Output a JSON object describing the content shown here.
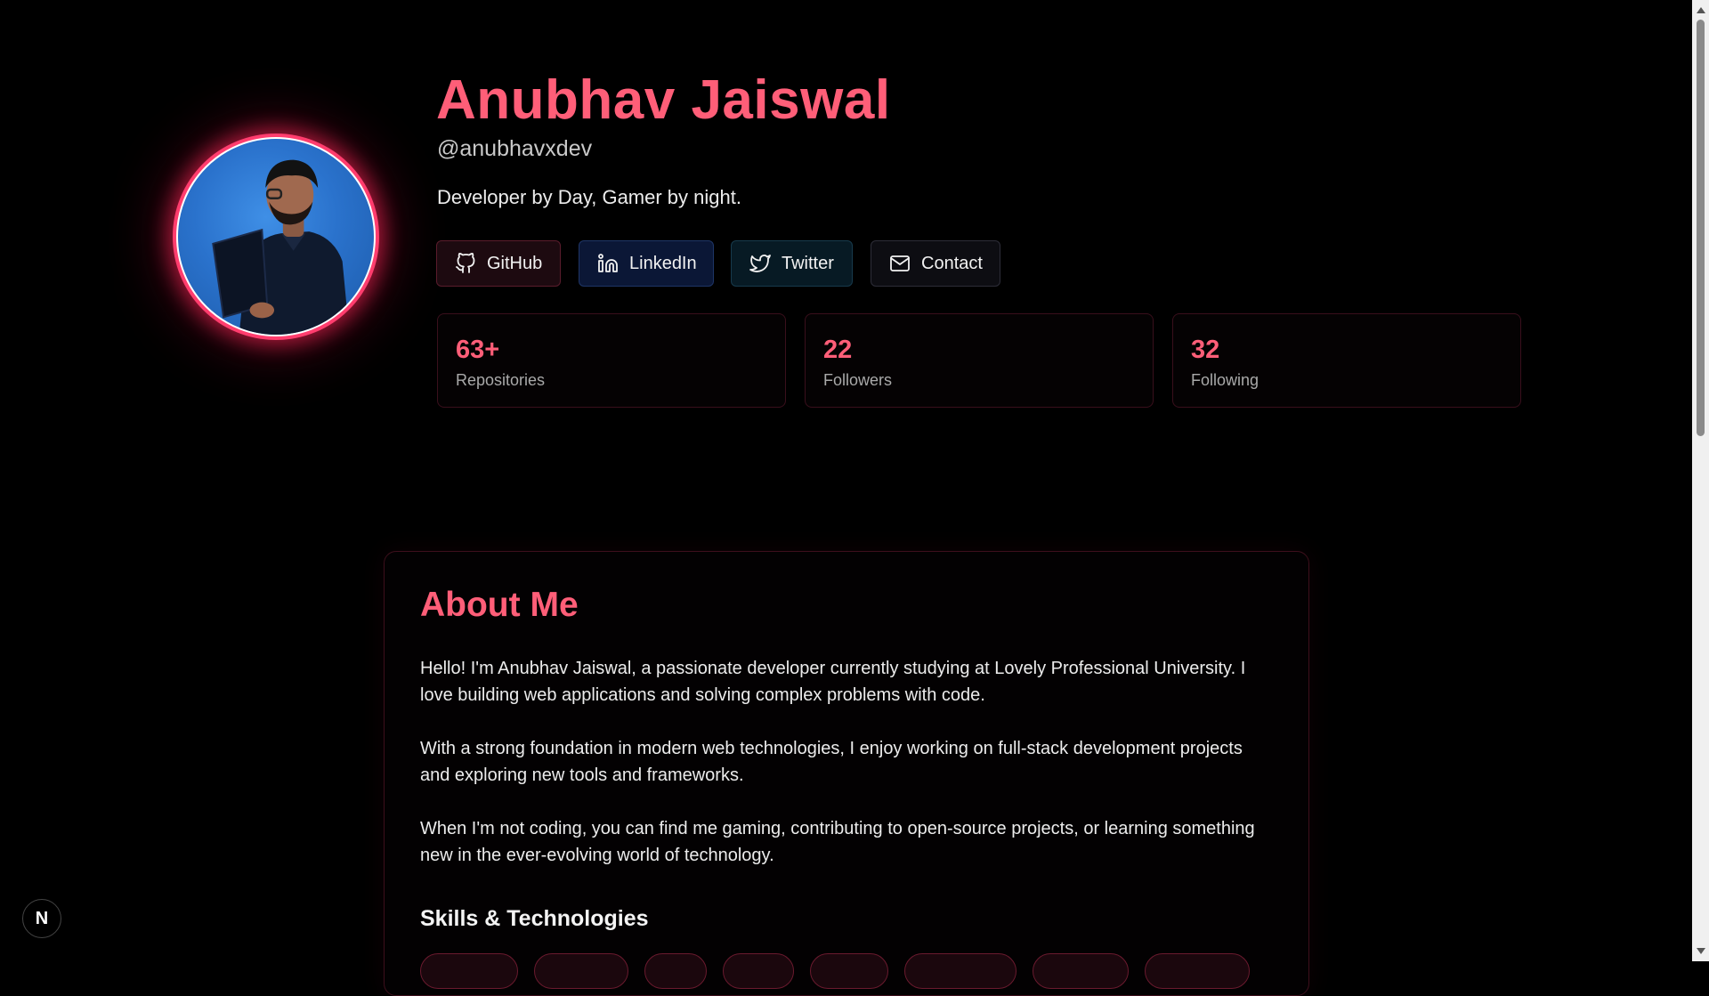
{
  "profile": {
    "name": "Anubhav Jaiswal",
    "handle": "@anubhavxdev",
    "tagline": "Developer by Day, Gamer by night.",
    "avatar_icon": "profile-photo"
  },
  "social": {
    "github": {
      "label": "GitHub",
      "icon": "github-icon"
    },
    "linkedin": {
      "label": "LinkedIn",
      "icon": "linkedin-icon"
    },
    "twitter": {
      "label": "Twitter",
      "icon": "twitter-icon"
    },
    "contact": {
      "label": "Contact",
      "icon": "mail-icon"
    }
  },
  "stats": [
    {
      "value": "63+",
      "label": "Repositories"
    },
    {
      "value": "22",
      "label": "Followers"
    },
    {
      "value": "32",
      "label": "Following"
    }
  ],
  "about": {
    "title": "About Me",
    "paragraphs": [
      "Hello! I'm Anubhav Jaiswal, a passionate developer currently studying at Lovely Professional University. I love building web applications and solving complex problems with code.",
      "With a strong foundation in modern web technologies, I enjoy working on full-stack development projects and exploring new tools and frameworks.",
      "When I'm not coding, you can find me gaming, contributing to open-source projects, or learning something new in the ever-evolving world of technology."
    ],
    "skills_title": "Skills & Technologies"
  },
  "next_badge": {
    "label": "N"
  },
  "colors": {
    "accent": "#ff5e78",
    "background": "#000000",
    "text": "#ececec"
  }
}
